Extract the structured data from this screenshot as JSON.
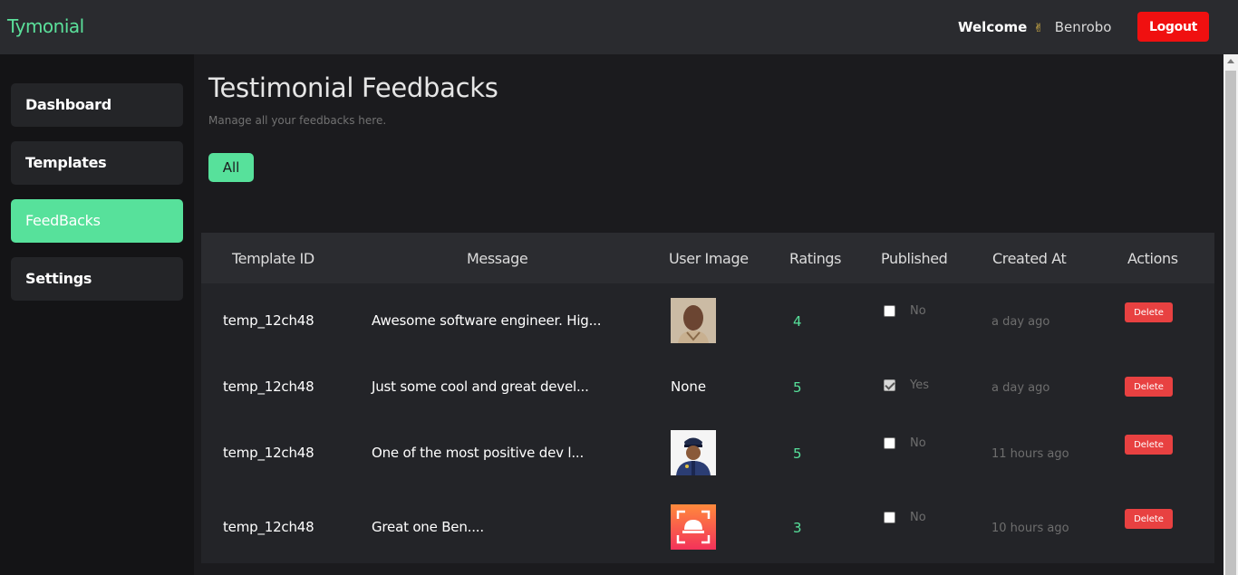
{
  "app": {
    "brand": "Tymonial"
  },
  "header": {
    "welcome_label": "Welcome",
    "welcome_icon": "✌",
    "username": "Benrobo",
    "logout_label": "Logout"
  },
  "sidebar": {
    "items": [
      {
        "label": "Dashboard",
        "active": false
      },
      {
        "label": "Templates",
        "active": false
      },
      {
        "label": "FeedBacks",
        "active": true
      },
      {
        "label": "Settings",
        "active": false
      }
    ]
  },
  "page": {
    "title": "Testimonial Feedbacks",
    "subtitle": "Manage all your feedbacks here.",
    "filter_all_label": "All"
  },
  "table": {
    "headers": [
      "Template ID",
      "Message",
      "User Image",
      "Ratings",
      "Published",
      "Created At",
      "Actions"
    ],
    "rows": [
      {
        "template_id": "temp_12ch48",
        "message": "Awesome software engineer. Hig...",
        "user_image": "avatar-portrait",
        "rating": "4",
        "published": false,
        "published_label": "No",
        "created_at": "a day ago",
        "action_label": "Delete"
      },
      {
        "template_id": "temp_12ch48",
        "message": "Just some cool and great devel...",
        "user_image": "None",
        "rating": "5",
        "published": true,
        "published_label": "Yes",
        "created_at": "a day ago",
        "action_label": "Delete"
      },
      {
        "template_id": "temp_12ch48",
        "message": "One of the most positive dev l...",
        "user_image": "avatar-police",
        "rating": "5",
        "published": false,
        "published_label": "No",
        "created_at": "11 hours ago",
        "action_label": "Delete"
      },
      {
        "template_id": "temp_12ch48",
        "message": "Great one Ben....",
        "user_image": "avatar-app-icon",
        "rating": "3",
        "published": false,
        "published_label": "No",
        "created_at": "10 hours ago",
        "action_label": "Delete"
      }
    ]
  },
  "colors": {
    "accent": "#57e19b",
    "danger": "#e84141",
    "logout": "#f01010"
  }
}
